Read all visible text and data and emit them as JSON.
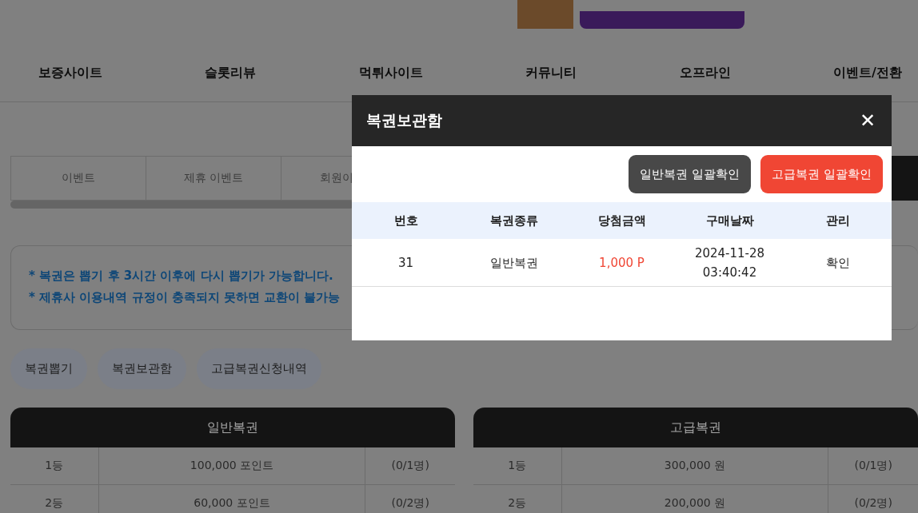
{
  "nav": [
    "보증사이트",
    "슬롯리뷰",
    "먹튀사이트",
    "커뮤니티",
    "오프라인",
    "이벤트/전환"
  ],
  "event_tabs": [
    {
      "label": "이벤트",
      "selected": false
    },
    {
      "label": "제휴 이벤트",
      "selected": false
    },
    {
      "label": "회원이",
      "selected": false
    },
    {
      "selected": true
    }
  ],
  "notice": [
    "* 복권은 뽑기 후 3시간 이후에 다시 뽑기가 가능합니다.",
    "* 제휴사 이용내역 규정이 충족되지 못하면 교환이 불가능"
  ],
  "pill_buttons": [
    "복권뽑기",
    "복권보관함",
    "고급복권신청내역"
  ],
  "prize_tables": [
    {
      "title": "일반복권",
      "rows": [
        [
          "1등",
          "100,000 포인트",
          "(0/1명)"
        ],
        [
          "2등",
          "60,000 포인트",
          "(0/2명)"
        ]
      ]
    },
    {
      "title": "고급복권",
      "rows": [
        [
          "1등",
          "300,000 원",
          "(0/1명)"
        ],
        [
          "2등",
          "200,000 원",
          "(0/2명)"
        ]
      ]
    }
  ],
  "modal": {
    "title": "복권보관함",
    "close": "✕",
    "buttons": [
      {
        "label": "일반복권 일괄확인",
        "kind": "dark"
      },
      {
        "label": "고급복권 일괄확인",
        "kind": "red"
      }
    ],
    "columns": [
      "번호",
      "복권종류",
      "당첨금액",
      "구매날짜",
      "관리"
    ],
    "rows": [
      {
        "number": "31",
        "type": "일반복권",
        "amount": "1,000 P",
        "date": [
          "2024-11-28",
          "03:40:42"
        ],
        "action": "확인"
      }
    ]
  }
}
